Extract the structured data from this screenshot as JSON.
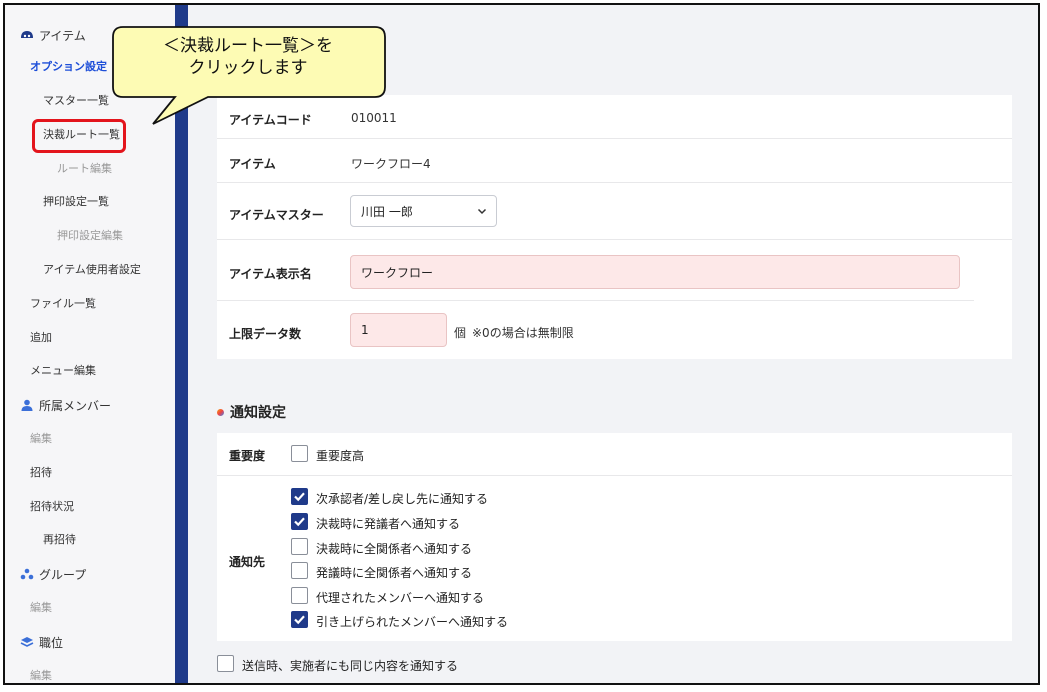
{
  "sidebar": {
    "items": [
      {
        "label": "アイテム",
        "icon": "item-icon"
      },
      {
        "label": "オプション設定"
      },
      {
        "label": "マスター一覧"
      },
      {
        "label": "決裁ルート一覧"
      },
      {
        "label": "ルート編集"
      },
      {
        "label": "押印設定一覧"
      },
      {
        "label": "押印設定編集"
      },
      {
        "label": "アイテム使用者設定"
      },
      {
        "label": "ファイル一覧"
      },
      {
        "label": "追加"
      },
      {
        "label": "メニュー編集"
      },
      {
        "label": "所属メンバー",
        "icon": "person-icon"
      },
      {
        "label": "編集"
      },
      {
        "label": "招待"
      },
      {
        "label": "招待状況"
      },
      {
        "label": "再招待"
      },
      {
        "label": "グループ",
        "icon": "group-icon"
      },
      {
        "label": "編集"
      },
      {
        "label": "職位",
        "icon": "layers-icon"
      },
      {
        "label": "編集"
      }
    ]
  },
  "callout": {
    "line1": "＜決裁ルート一覧＞を",
    "line2": "クリックします"
  },
  "form": {
    "item_code_label": "アイテムコード",
    "item_code_value": "010011",
    "item_label": "アイテム",
    "item_value": "ワークフロー4",
    "master_label": "アイテムマスター",
    "master_value": "川田 一郎",
    "display_name_label": "アイテム表示名",
    "display_name_value": "ワークフロー",
    "limit_label": "上限データ数",
    "limit_value": "1",
    "limit_unit": "個",
    "limit_note": "※0の場合は無制限"
  },
  "notify": {
    "section_title": "通知設定",
    "importance_label": "重要度",
    "importance_option": "重要度高",
    "importance_checked": false,
    "dest_label": "通知先",
    "options": [
      {
        "label": "次承認者/差し戻し先に通知する",
        "checked": true
      },
      {
        "label": "決裁時に発議者へ通知する",
        "checked": true
      },
      {
        "label": "決裁時に全関係者へ通知する",
        "checked": false
      },
      {
        "label": "発議時に全関係者へ通知する",
        "checked": false
      },
      {
        "label": "代理されたメンバーへ通知する",
        "checked": false
      },
      {
        "label": "引き上げられたメンバーへ通知する",
        "checked": true
      }
    ],
    "send_label": "送信時、実施者にも同じ内容を通知する",
    "send_checked": false
  },
  "colors": {
    "accent": "#1f3a8a",
    "highlight": "#e3141c",
    "callout": "#fdfbb4",
    "pink_input": "#fde8e8"
  }
}
